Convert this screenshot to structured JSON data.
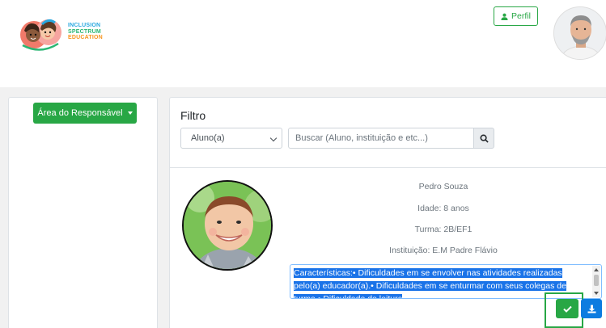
{
  "header": {
    "logo": {
      "line1": "INCLUSION",
      "line2": "SPECTRUM",
      "line3": "EDUCATION"
    },
    "profile_button": {
      "label": "Perfil",
      "icon": "user-icon"
    },
    "avatar": {
      "icon": "user-avatar"
    }
  },
  "sidebar": {
    "dropdown_label": "Área do Responsável"
  },
  "filter": {
    "title": "Filtro",
    "select_value": "Aluno(a)",
    "search_placeholder": "Buscar (Aluno, instituição e etc...)",
    "search_icon": "search-icon"
  },
  "student": {
    "name": "Pedro Souza",
    "age": "Idade: 8 anos",
    "class": "Turma: 2B/EF1",
    "institution": "Instituição: E.M Padre Flávio",
    "characteristics": "Características:• Dificuldades em se envolver nas atividades realizadas pelo(a) educador(a).• Dificuldades em se enturmar com seus colegas de turma.• Dificuldade de leitura"
  },
  "actions": {
    "confirm_icon": "check-icon",
    "download_icon": "download-icon"
  },
  "colors": {
    "primary_green": "#28a745",
    "primary_blue": "#0d7ce0",
    "selection_blue": "#1a73e8",
    "background": "#f1f1f1"
  }
}
